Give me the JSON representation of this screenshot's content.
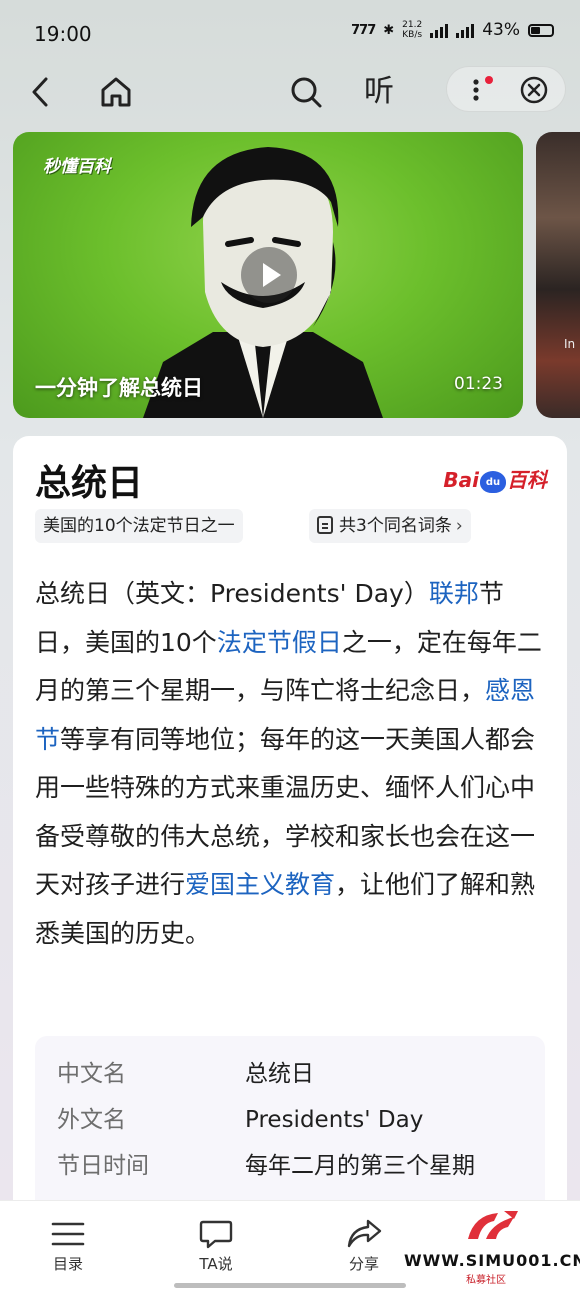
{
  "status_bar": {
    "time": "19:00",
    "net_speed_value": "21.2",
    "net_speed_unit": "KB/s",
    "sim1": "5G HD",
    "sim2": "5G HD",
    "battery": "43%"
  },
  "nav": {
    "listen_label": "听"
  },
  "video": {
    "logo_text": "秒懂百科",
    "title": "一分钟了解总统日",
    "duration": "01:23",
    "next_card_text": "In"
  },
  "article": {
    "title": "总统日",
    "source_logo": "Bai du 百科",
    "tag_chip": "美国的10个法定节日之一",
    "homonym_chip": "共3个同名词条",
    "body": [
      {
        "text": "总统日（英文：Presidents' Day）",
        "link": false
      },
      {
        "text": "联邦",
        "link": true
      },
      {
        "text": "节日，美国的10个",
        "link": false
      },
      {
        "text": "法定节假日",
        "link": true
      },
      {
        "text": "之一，定在每年二月的第三个星期一，与阵亡将士纪念日，",
        "link": false
      },
      {
        "text": "感恩节",
        "link": true
      },
      {
        "text": "等享有同等地位；每年的这一天美国人都会用一些特殊的方式来重温历史、缅怀人们心中备受尊敬的伟大总统，学校和家长也会在这一天对孩子进行",
        "link": false
      },
      {
        "text": "爱国主义教育",
        "link": true
      },
      {
        "text": "，让他们了解和熟悉美国的历史。",
        "link": false
      }
    ],
    "info": [
      {
        "key": "中文名",
        "value": "总统日"
      },
      {
        "key": "外文名",
        "value": "Presidents' Day"
      },
      {
        "key": "节日时间",
        "value": "每年二月的第三个星期"
      }
    ]
  },
  "bottom_bar": {
    "toc_label": "目录",
    "ta_label": "TA说",
    "share_label": "分享"
  },
  "watermark": {
    "site": "WWW.SIMU001.CN",
    "sub": "私募社区"
  },
  "colors": {
    "link": "#1d64c0",
    "accent_red": "#d5202a",
    "notification_dot": "#e8213b"
  }
}
